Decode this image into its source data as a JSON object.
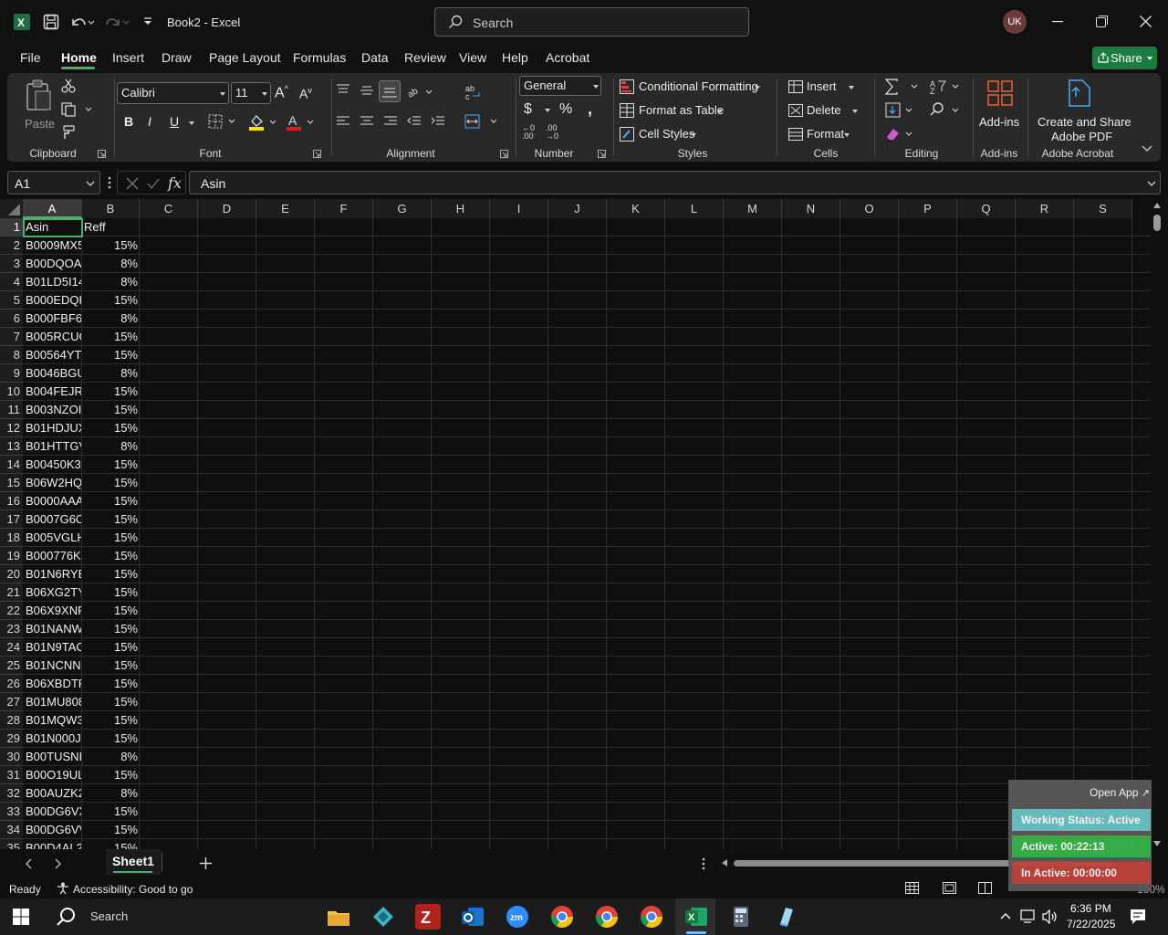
{
  "window": {
    "app_name": "Book2  -  Excel",
    "search_placeholder": "Search",
    "user_initials": "UK"
  },
  "ribbon_tabs": [
    "File",
    "Home",
    "Insert",
    "Draw",
    "Page Layout",
    "Formulas",
    "Data",
    "Review",
    "View",
    "Help",
    "Acrobat"
  ],
  "share_label": "Share",
  "ribbon": {
    "clipboard": {
      "paste": "Paste",
      "label": "Clipboard"
    },
    "font": {
      "name": "Calibri",
      "size": "11",
      "label": "Font",
      "highlight_color": "#ffe600",
      "font_color": "#e01b1b"
    },
    "alignment": {
      "label": "Alignment"
    },
    "number": {
      "format": "General",
      "label": "Number"
    },
    "styles": {
      "conditional": "Conditional Formatting",
      "format_table": "Format as Table",
      "cell_styles": "Cell Styles",
      "label": "Styles"
    },
    "cells": {
      "insert": "Insert",
      "delete": "Delete",
      "format": "Format",
      "label": "Cells"
    },
    "editing": {
      "label": "Editing"
    },
    "addins": {
      "button": "Add-ins",
      "label": "Add-ins"
    },
    "acrobat": {
      "button_line1": "Create and Share",
      "button_line2": "Adobe PDF",
      "label": "Adobe Acrobat"
    }
  },
  "formula_bar": {
    "name_box": "A1",
    "content": "Asin"
  },
  "columns": [
    "A",
    "B",
    "C",
    "D",
    "E",
    "F",
    "G",
    "H",
    "I",
    "J",
    "K",
    "L",
    "M",
    "N",
    "O",
    "P",
    "Q",
    "R",
    "S"
  ],
  "rows": [
    {
      "n": "1",
      "a": "Asin",
      "b": "Reff"
    },
    {
      "n": "2",
      "a": "B0009MX5",
      "b": "15%"
    },
    {
      "n": "3",
      "a": "B00DQOA",
      "b": "8%"
    },
    {
      "n": "4",
      "a": "B01LD5I14",
      "b": "8%"
    },
    {
      "n": "5",
      "a": "B000EDQK",
      "b": "15%"
    },
    {
      "n": "6",
      "a": "B000FBF6I",
      "b": "8%"
    },
    {
      "n": "7",
      "a": "B005RCUG",
      "b": "15%"
    },
    {
      "n": "8",
      "a": "B00564YT4",
      "b": "15%"
    },
    {
      "n": "9",
      "a": "B0046BGU",
      "b": "8%"
    },
    {
      "n": "10",
      "a": "B004FEJR6",
      "b": "15%"
    },
    {
      "n": "11",
      "a": "B003NZOI",
      "b": "15%"
    },
    {
      "n": "12",
      "a": "B01HDJUX",
      "b": "15%"
    },
    {
      "n": "13",
      "a": "B01HTTGV",
      "b": "8%"
    },
    {
      "n": "14",
      "a": "B00450K34",
      "b": "15%"
    },
    {
      "n": "15",
      "a": "B06W2HQ",
      "b": "15%"
    },
    {
      "n": "16",
      "a": "B0000AAA",
      "b": "15%"
    },
    {
      "n": "17",
      "a": "B0007G6O",
      "b": "15%"
    },
    {
      "n": "18",
      "a": "B005VGLH",
      "b": "15%"
    },
    {
      "n": "19",
      "a": "B000776K5",
      "b": "15%"
    },
    {
      "n": "20",
      "a": "B01N6RYB",
      "b": "15%"
    },
    {
      "n": "21",
      "a": "B06XG2TY",
      "b": "15%"
    },
    {
      "n": "22",
      "a": "B06X9XNR",
      "b": "15%"
    },
    {
      "n": "23",
      "a": "B01NANW",
      "b": "15%"
    },
    {
      "n": "24",
      "a": "B01N9TAC",
      "b": "15%"
    },
    {
      "n": "25",
      "a": "B01NCNN",
      "b": "15%"
    },
    {
      "n": "26",
      "a": "B06XBDTF",
      "b": "15%"
    },
    {
      "n": "27",
      "a": "B01MU808",
      "b": "15%"
    },
    {
      "n": "28",
      "a": "B01MQW3",
      "b": "15%"
    },
    {
      "n": "29",
      "a": "B01N000J7",
      "b": "15%"
    },
    {
      "n": "30",
      "a": "B00TUSNI",
      "b": "8%"
    },
    {
      "n": "31",
      "a": "B00O19UL",
      "b": "15%"
    },
    {
      "n": "32",
      "a": "B00AUZK2",
      "b": "8%"
    },
    {
      "n": "33",
      "a": "B00DG6VX",
      "b": "15%"
    },
    {
      "n": "34",
      "a": "B00DG6VV",
      "b": "15%"
    },
    {
      "n": "35",
      "a": "B00D4AL2",
      "b": "15%"
    }
  ],
  "sheet_tab": "Sheet1",
  "status": {
    "ready": "Ready",
    "accessibility": "Accessibility: Good to go",
    "zoom": "100%"
  },
  "widget": {
    "open_app": "Open App",
    "working": "Working Status: Active",
    "active": "Active: 00:22:13",
    "inactive": "In Active: 00:00:00"
  },
  "taskbar": {
    "search": "Search",
    "time": "6:36 PM",
    "date": "7/22/2025"
  }
}
